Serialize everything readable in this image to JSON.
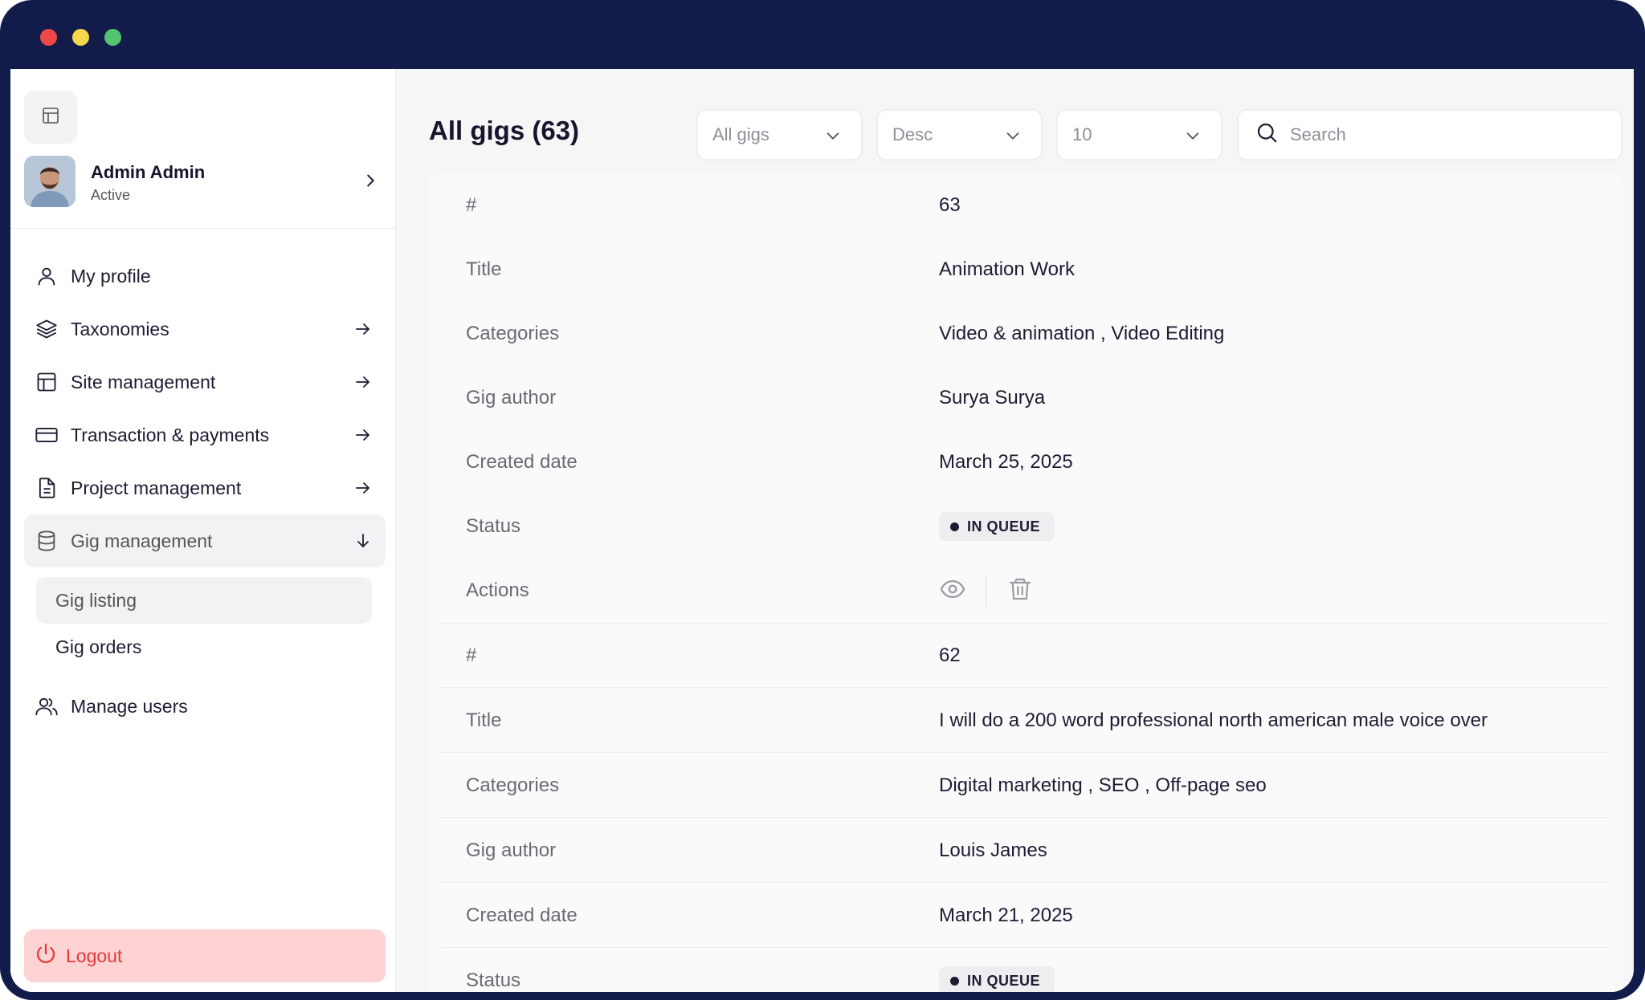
{
  "window": {
    "controls": [
      "close",
      "minimize",
      "maximize"
    ]
  },
  "sidebar": {
    "toggle_icon": "layout-icon",
    "profile": {
      "name": "Admin Admin",
      "status": "Active"
    },
    "nav": [
      {
        "label": "My profile",
        "icon": "user-icon",
        "has_arrow": false
      },
      {
        "label": "Taxonomies",
        "icon": "layers-icon",
        "has_arrow": true
      },
      {
        "label": "Site management",
        "icon": "layout-icon",
        "has_arrow": true
      },
      {
        "label": "Transaction & payments",
        "icon": "credit-card-icon",
        "has_arrow": true
      },
      {
        "label": "Project management",
        "icon": "file-icon",
        "has_arrow": true
      },
      {
        "label": "Gig management",
        "icon": "database-icon",
        "expanded": true
      }
    ],
    "sub_nav": [
      {
        "label": "Gig listing",
        "active": true
      },
      {
        "label": "Gig orders",
        "active": false
      }
    ],
    "manage_users": "Manage users",
    "logout": "Logout"
  },
  "header": {
    "title": "All gigs (63)",
    "filter": {
      "selected": "All gigs"
    },
    "sort": {
      "selected": "Desc"
    },
    "per_page": {
      "selected": "10"
    },
    "search": {
      "placeholder": "Search"
    }
  },
  "table": {
    "labels": {
      "id": "#",
      "title": "Title",
      "categories": "Categories",
      "author": "Gig author",
      "created": "Created date",
      "status": "Status",
      "actions": "Actions"
    },
    "rows": [
      {
        "id": "63",
        "title": "Animation Work",
        "categories": "Video & animation , Video Editing",
        "author": "Surya Surya",
        "created": "March 25, 2025",
        "status": "IN QUEUE"
      },
      {
        "id": "62",
        "title": "I will do a 200 word professional north american male voice over",
        "categories": "Digital marketing , SEO , Off-page seo",
        "author": "Louis James",
        "created": "March 21, 2025",
        "status": "IN QUEUE"
      }
    ]
  },
  "colors": {
    "frame": "#121c4a",
    "logout_bg": "#ffd3d3",
    "logout_text": "#e53939"
  }
}
